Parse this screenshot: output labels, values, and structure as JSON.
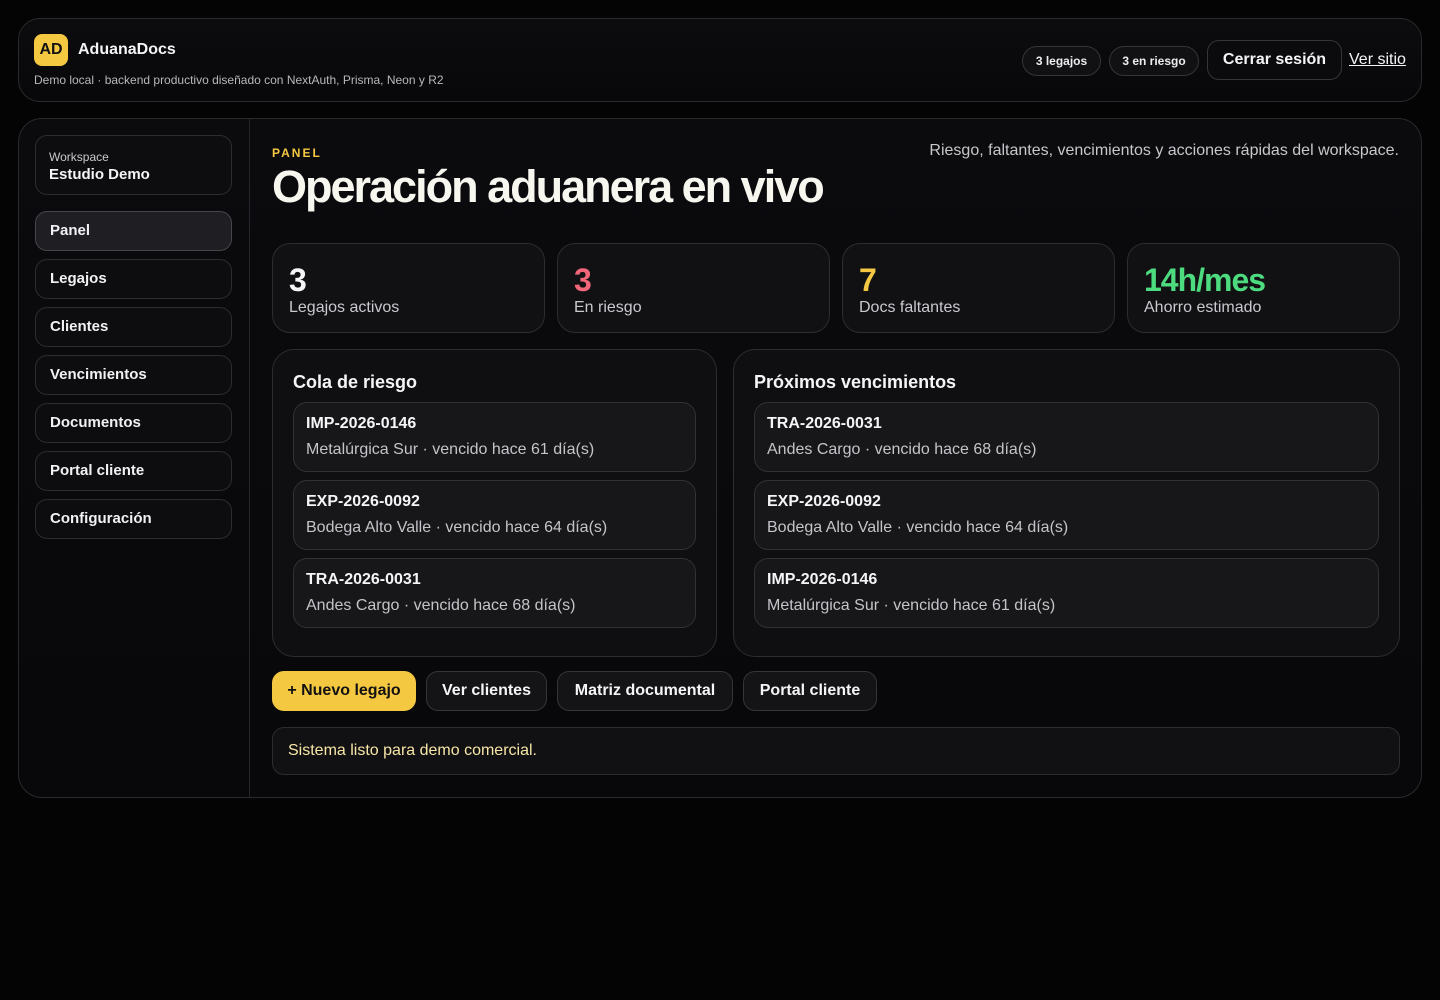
{
  "header": {
    "logo_text": "AD",
    "brand": "AduanaDocs",
    "subtitle": "Demo local · backend productivo diseñado con NextAuth, Prisma, Neon y R2",
    "badges": [
      "3 legajos",
      "3 en riesgo"
    ],
    "logout_label": "Cerrar sesión",
    "site_link": "Ver sitio"
  },
  "sidebar": {
    "workspace_label": "Workspace",
    "workspace_name": "Estudio Demo",
    "items": [
      {
        "label": "Panel",
        "active": true
      },
      {
        "label": "Legajos",
        "active": false
      },
      {
        "label": "Clientes",
        "active": false
      },
      {
        "label": "Vencimientos",
        "active": false
      },
      {
        "label": "Documentos",
        "active": false
      },
      {
        "label": "Portal cliente",
        "active": false
      },
      {
        "label": "Configuración",
        "active": false
      }
    ]
  },
  "main": {
    "eyebrow": "PANEL",
    "title": "Operación aduanera en vivo",
    "description": "Riesgo, faltantes, vencimientos y acciones rápidas del workspace.",
    "stats": [
      {
        "value": "3",
        "label": "Legajos activos",
        "color": "#f5f5f7"
      },
      {
        "value": "3",
        "label": "En riesgo",
        "color": "#f2667a"
      },
      {
        "value": "7",
        "label": "Docs faltantes",
        "color": "#f5c842"
      },
      {
        "value": "14h/mes",
        "label": "Ahorro estimado",
        "color": "#4ddb7f"
      }
    ],
    "risk_queue": {
      "title": "Cola de riesgo",
      "items": [
        {
          "code": "IMP-2026-0146",
          "meta": "Metalúrgica Sur · vencido hace 61 día(s)"
        },
        {
          "code": "EXP-2026-0092",
          "meta": "Bodega Alto Valle · vencido hace 64 día(s)"
        },
        {
          "code": "TRA-2026-0031",
          "meta": "Andes Cargo · vencido hace 68 día(s)"
        }
      ]
    },
    "upcoming": {
      "title": "Próximos vencimientos",
      "items": [
        {
          "code": "TRA-2026-0031",
          "meta": "Andes Cargo · vencido hace 68 día(s)"
        },
        {
          "code": "EXP-2026-0092",
          "meta": "Bodega Alto Valle · vencido hace 64 día(s)"
        },
        {
          "code": "IMP-2026-0146",
          "meta": "Metalúrgica Sur · vencido hace 61 día(s)"
        }
      ]
    },
    "actions": [
      "+ Nuevo legajo",
      "Ver clientes",
      "Matriz documental",
      "Portal cliente"
    ],
    "status_message": "Sistema listo para demo comercial."
  }
}
